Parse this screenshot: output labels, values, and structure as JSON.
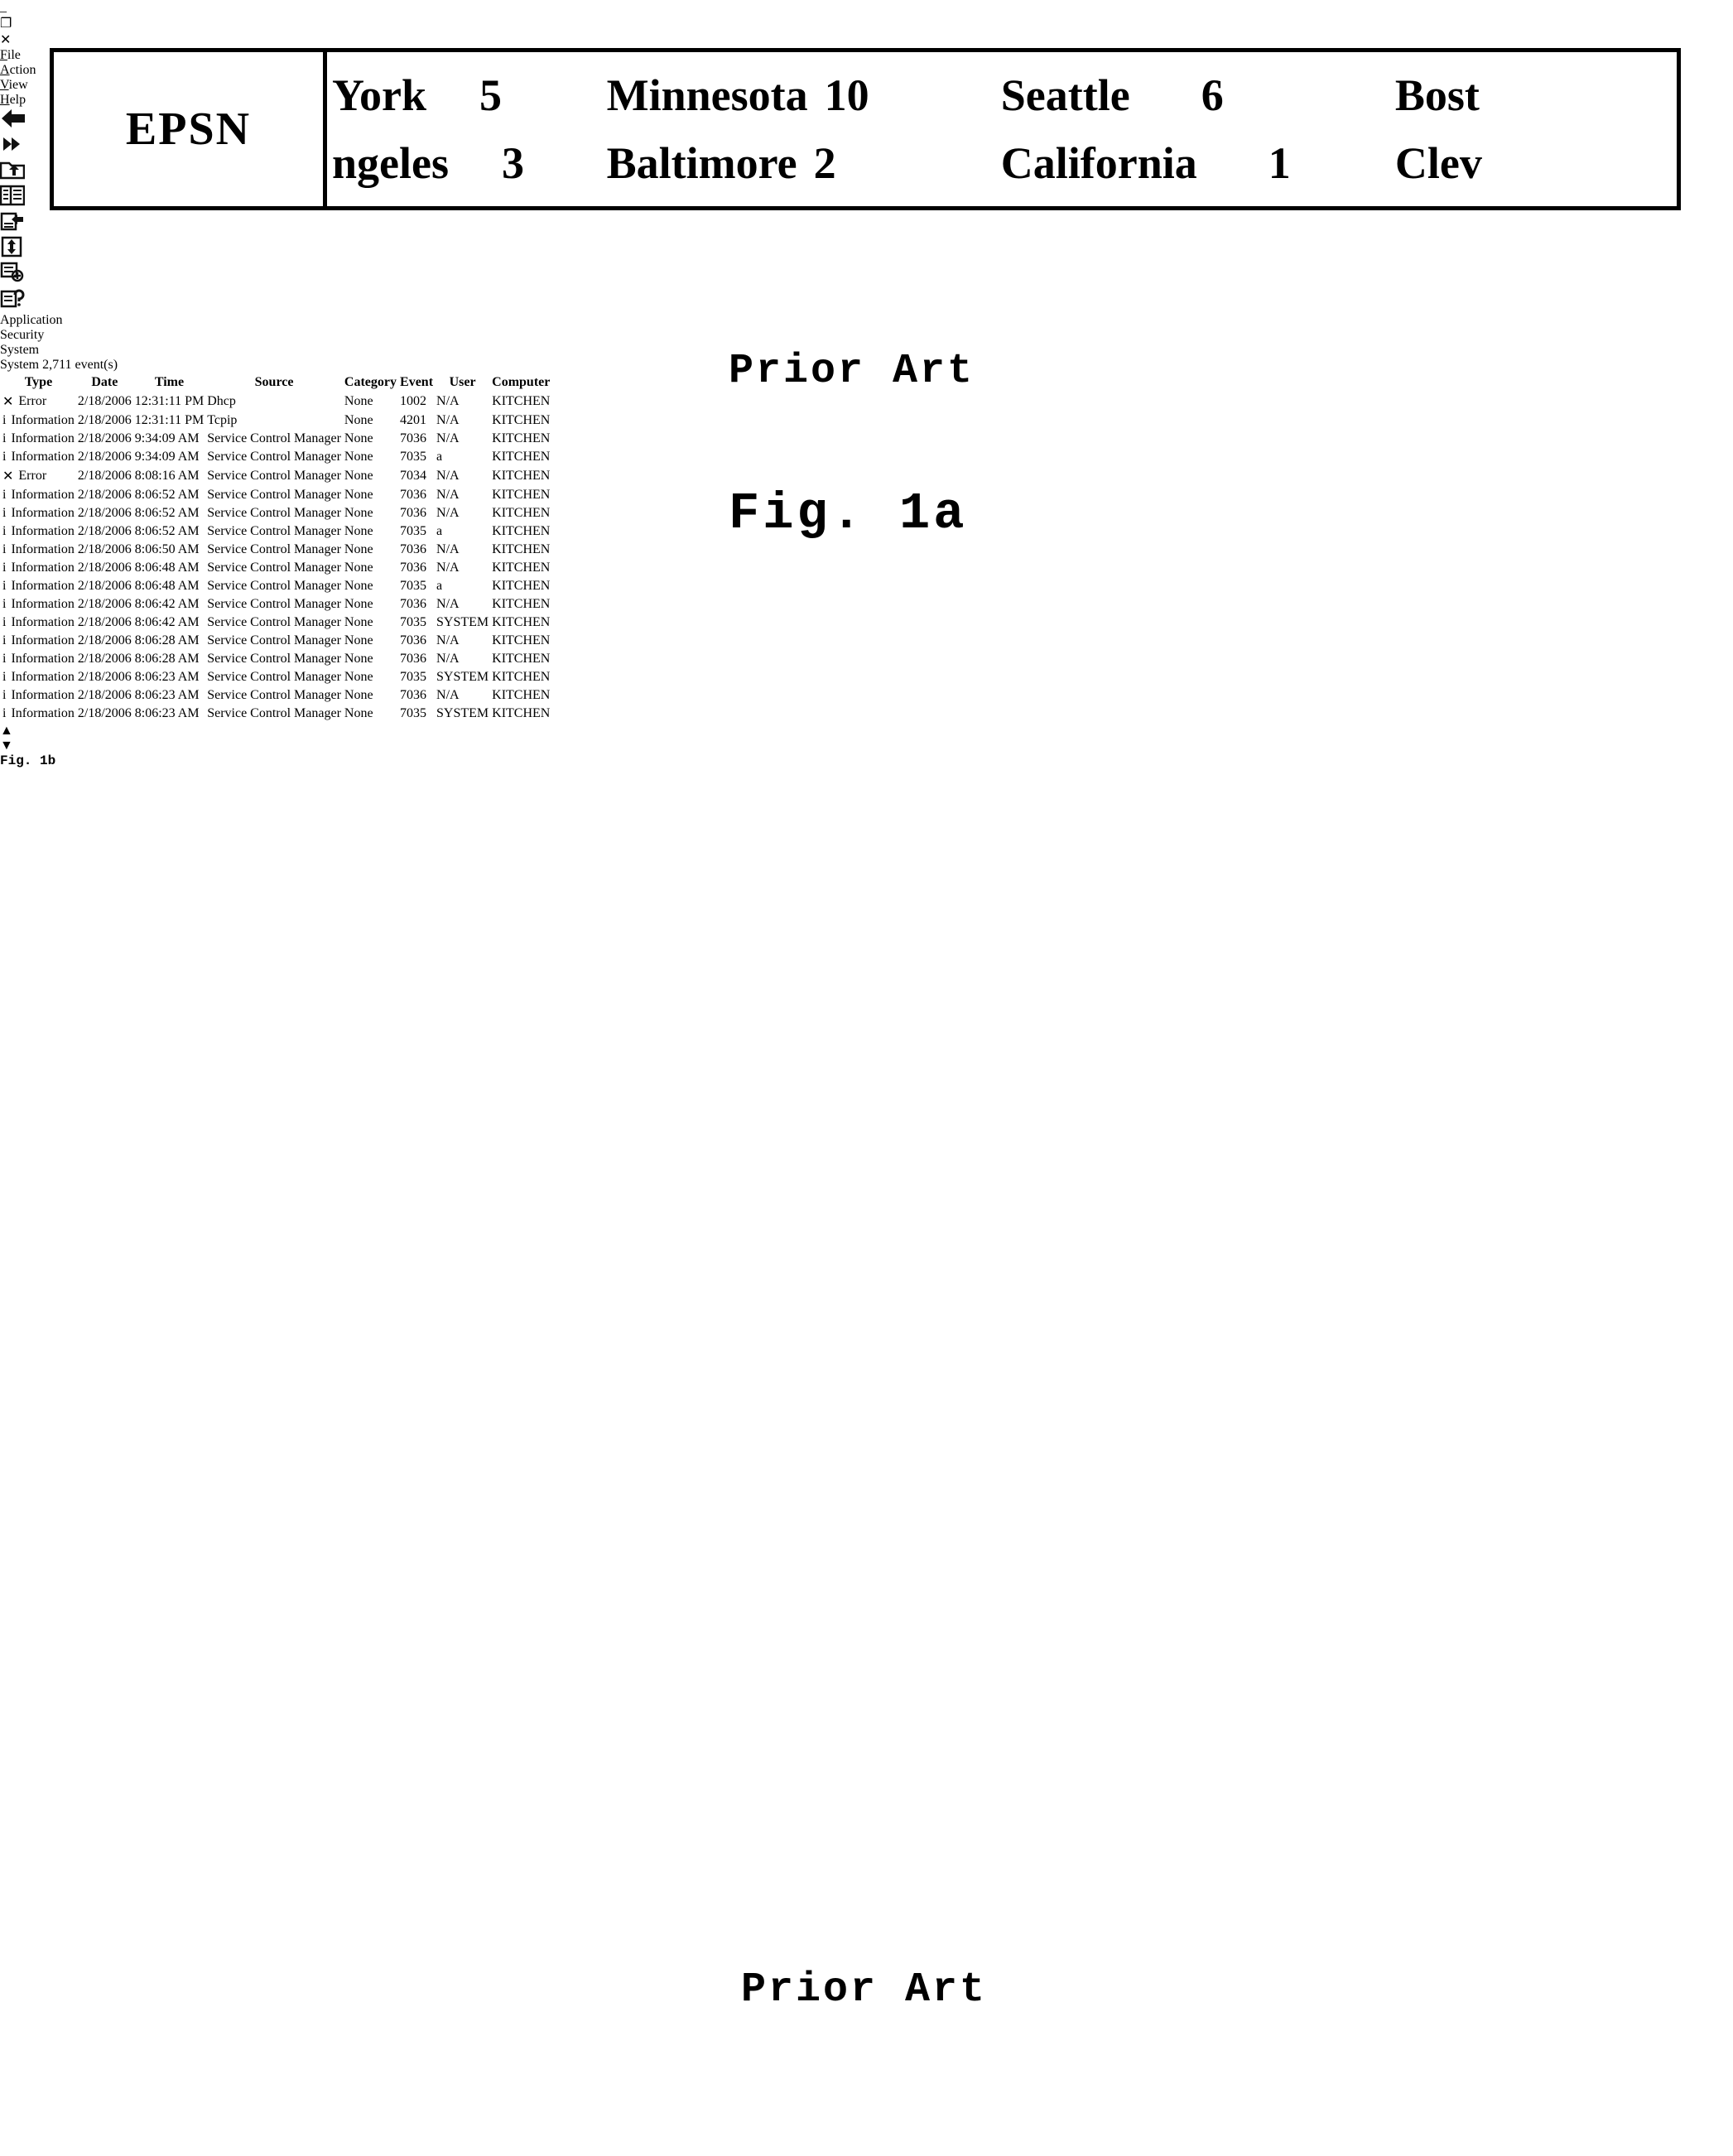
{
  "figure_1a": {
    "caption_top": "Prior Art",
    "caption_fig": "Fig. 1a",
    "ticker": {
      "logo": "EPSN",
      "row1": [
        {
          "team": "York",
          "score": "5"
        },
        {
          "team": "Minnesota",
          "score": "10"
        },
        {
          "team": "Seattle",
          "score": "6"
        },
        {
          "team": "Bost",
          "score": ""
        }
      ],
      "row2": [
        {
          "team": "ngeles",
          "score": "3"
        },
        {
          "team": "Baltimore",
          "score": "2"
        },
        {
          "team": "California",
          "score": "1"
        },
        {
          "team": "Clev",
          "score": ""
        }
      ]
    }
  },
  "figure_1b": {
    "caption_top": "Prior Art",
    "caption_fig": "Fig. 1b",
    "window": {
      "title": "",
      "window_buttons": {
        "minimize": "_",
        "maximize": "❐",
        "close": "✕"
      },
      "menu": [
        {
          "accel": "F",
          "rest": "ile"
        },
        {
          "accel": "A",
          "rest": "ction"
        },
        {
          "accel": "V",
          "rest": "iew"
        },
        {
          "accel": "H",
          "rest": "elp"
        }
      ],
      "toolbar": [
        "back-icon",
        "forward-icon",
        "up-one-level-icon",
        "show-hide-tree-icon",
        "export-list-icon",
        "refresh-icon",
        "properties-icon",
        "help-icon"
      ],
      "tree": {
        "root_label": "",
        "items": [
          {
            "label": "Application",
            "selected": false
          },
          {
            "label": "Security",
            "selected": false
          },
          {
            "label": "System",
            "selected": true
          }
        ]
      },
      "list": {
        "caption_log": "System",
        "caption_count": "2,711 event(s)",
        "columns": [
          "Type",
          "Date",
          "Time",
          "Source",
          "Category",
          "Event",
          "User",
          "Computer"
        ],
        "rows": [
          {
            "type": "Error",
            "icon": "error-icon",
            "date": "2/18/2006",
            "time": "12:31:11 PM",
            "source": "Dhcp",
            "category": "None",
            "event": "1002",
            "user": "N/A",
            "computer": "KITCHEN"
          },
          {
            "type": "Information",
            "icon": "info-icon",
            "date": "2/18/2006",
            "time": "12:31:11 PM",
            "source": "Tcpip",
            "category": "None",
            "event": "4201",
            "user": "N/A",
            "computer": "KITCHEN"
          },
          {
            "type": "Information",
            "icon": "info-icon",
            "date": "2/18/2006",
            "time": "9:34:09 AM",
            "source": "Service Control Manager",
            "category": "None",
            "event": "7036",
            "user": "N/A",
            "computer": "KITCHEN"
          },
          {
            "type": "Information",
            "icon": "info-icon",
            "date": "2/18/2006",
            "time": "9:34:09 AM",
            "source": "Service Control Manager",
            "category": "None",
            "event": "7035",
            "user": "a",
            "computer": "KITCHEN"
          },
          {
            "type": "Error",
            "icon": "error-icon",
            "date": "2/18/2006",
            "time": "8:08:16 AM",
            "source": "Service Control Manager",
            "category": "None",
            "event": "7034",
            "user": "N/A",
            "computer": "KITCHEN"
          },
          {
            "type": "Information",
            "icon": "info-icon",
            "date": "2/18/2006",
            "time": "8:06:52 AM",
            "source": "Service Control Manager",
            "category": "None",
            "event": "7036",
            "user": "N/A",
            "computer": "KITCHEN"
          },
          {
            "type": "Information",
            "icon": "info-icon",
            "date": "2/18/2006",
            "time": "8:06:52 AM",
            "source": "Service Control Manager",
            "category": "None",
            "event": "7036",
            "user": "N/A",
            "computer": "KITCHEN"
          },
          {
            "type": "Information",
            "icon": "info-icon",
            "date": "2/18/2006",
            "time": "8:06:52 AM",
            "source": "Service Control Manager",
            "category": "None",
            "event": "7035",
            "user": "a",
            "computer": "KITCHEN"
          },
          {
            "type": "Information",
            "icon": "info-icon",
            "date": "2/18/2006",
            "time": "8:06:50 AM",
            "source": "Service Control Manager",
            "category": "None",
            "event": "7036",
            "user": "N/A",
            "computer": "KITCHEN"
          },
          {
            "type": "Information",
            "icon": "info-icon",
            "date": "2/18/2006",
            "time": "8:06:48 AM",
            "source": "Service Control Manager",
            "category": "None",
            "event": "7036",
            "user": "N/A",
            "computer": "KITCHEN"
          },
          {
            "type": "Information",
            "icon": "info-icon",
            "date": "2/18/2006",
            "time": "8:06:48 AM",
            "source": "Service Control Manager",
            "category": "None",
            "event": "7035",
            "user": "a",
            "computer": "KITCHEN"
          },
          {
            "type": "Information",
            "icon": "info-icon",
            "date": "2/18/2006",
            "time": "8:06:42 AM",
            "source": "Service Control Manager",
            "category": "None",
            "event": "7036",
            "user": "N/A",
            "computer": "KITCHEN"
          },
          {
            "type": "Information",
            "icon": "info-icon",
            "date": "2/18/2006",
            "time": "8:06:42 AM",
            "source": "Service Control Manager",
            "category": "None",
            "event": "7035",
            "user": "SYSTEM",
            "computer": "KITCHEN"
          },
          {
            "type": "Information",
            "icon": "info-icon",
            "date": "2/18/2006",
            "time": "8:06:28 AM",
            "source": "Service Control Manager",
            "category": "None",
            "event": "7036",
            "user": "N/A",
            "computer": "KITCHEN"
          },
          {
            "type": "Information",
            "icon": "info-icon",
            "date": "2/18/2006",
            "time": "8:06:28 AM",
            "source": "Service Control Manager",
            "category": "None",
            "event": "7036",
            "user": "N/A",
            "computer": "KITCHEN"
          },
          {
            "type": "Information",
            "icon": "info-icon",
            "date": "2/18/2006",
            "time": "8:06:23 AM",
            "source": "Service Control Manager",
            "category": "None",
            "event": "7035",
            "user": "SYSTEM",
            "computer": "KITCHEN"
          },
          {
            "type": "Information",
            "icon": "info-icon",
            "date": "2/18/2006",
            "time": "8:06:23 AM",
            "source": "Service Control Manager",
            "category": "None",
            "event": "7036",
            "user": "N/A",
            "computer": "KITCHEN"
          },
          {
            "type": "Information",
            "icon": "info-icon",
            "date": "2/18/2006",
            "time": "8:06:23 AM",
            "source": "Service Control Manager",
            "category": "None",
            "event": "7035",
            "user": "SYSTEM",
            "computer": "KITCHEN"
          }
        ],
        "scrollbar": {
          "up": "▲",
          "down": "▼"
        }
      }
    }
  }
}
